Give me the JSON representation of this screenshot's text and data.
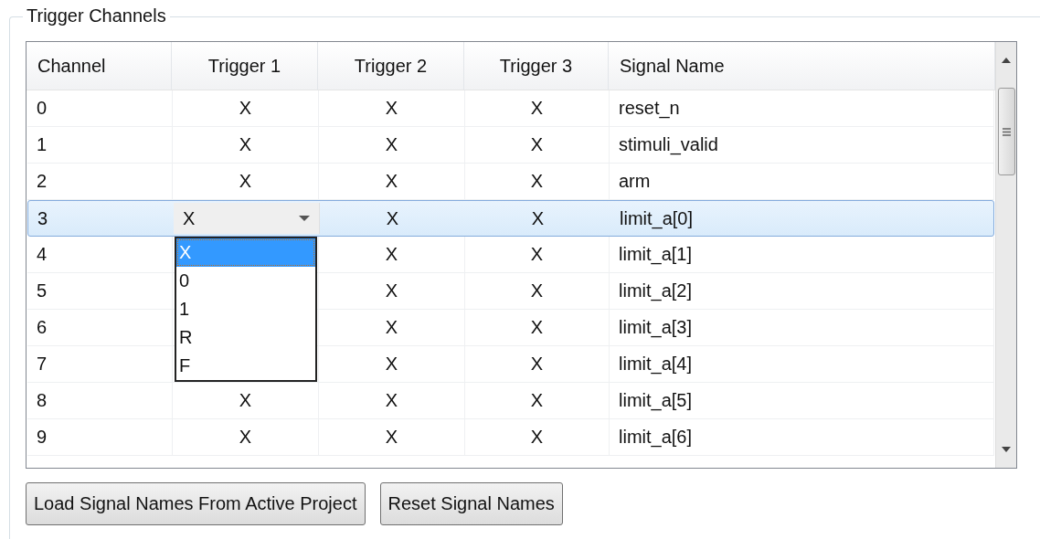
{
  "group": {
    "title": "Trigger Channels"
  },
  "table": {
    "columns": [
      "Channel",
      "Trigger 1",
      "Trigger 2",
      "Trigger 3",
      "Signal Name"
    ],
    "rows": [
      {
        "channel": "0",
        "trigger_1": "X",
        "trigger_2": "X",
        "trigger_3": "X",
        "signal_name": "reset_n",
        "selected": false
      },
      {
        "channel": "1",
        "trigger_1": "X",
        "trigger_2": "X",
        "trigger_3": "X",
        "signal_name": "stimuli_valid",
        "selected": false
      },
      {
        "channel": "2",
        "trigger_1": "X",
        "trigger_2": "X",
        "trigger_3": "X",
        "signal_name": "arm",
        "selected": false
      },
      {
        "channel": "3",
        "editor": {
          "value": "X",
          "options": [
            {
              "label": "X",
              "selected": true
            },
            {
              "label": "0",
              "selected": false
            },
            {
              "label": "1",
              "selected": false
            },
            {
              "label": "R",
              "selected": false
            },
            {
              "label": "F",
              "selected": false
            }
          ]
        },
        "trigger_2": "X",
        "trigger_3": "X",
        "signal_name": "limit_a[0]",
        "selected": true
      },
      {
        "channel": "4",
        "trigger_2": "X",
        "trigger_3": "X",
        "signal_name": "limit_a[1]",
        "selected": false
      },
      {
        "channel": "5",
        "trigger_2": "X",
        "trigger_3": "X",
        "signal_name": "limit_a[2]",
        "selected": false
      },
      {
        "channel": "6",
        "trigger_2": "X",
        "trigger_3": "X",
        "signal_name": "limit_a[3]",
        "selected": false
      },
      {
        "channel": "7",
        "trigger_2": "X",
        "trigger_3": "X",
        "signal_name": "limit_a[4]",
        "selected": false
      },
      {
        "channel": "8",
        "trigger_1": "X",
        "trigger_2": "X",
        "trigger_3": "X",
        "signal_name": "limit_a[5]",
        "selected": false
      },
      {
        "channel": "9",
        "trigger_1": "X",
        "trigger_2": "X",
        "trigger_3": "X",
        "signal_name": "limit_a[6]",
        "selected": false
      }
    ]
  },
  "buttons": [
    "Load Signal Names From Active Project",
    "Reset Signal Names"
  ]
}
